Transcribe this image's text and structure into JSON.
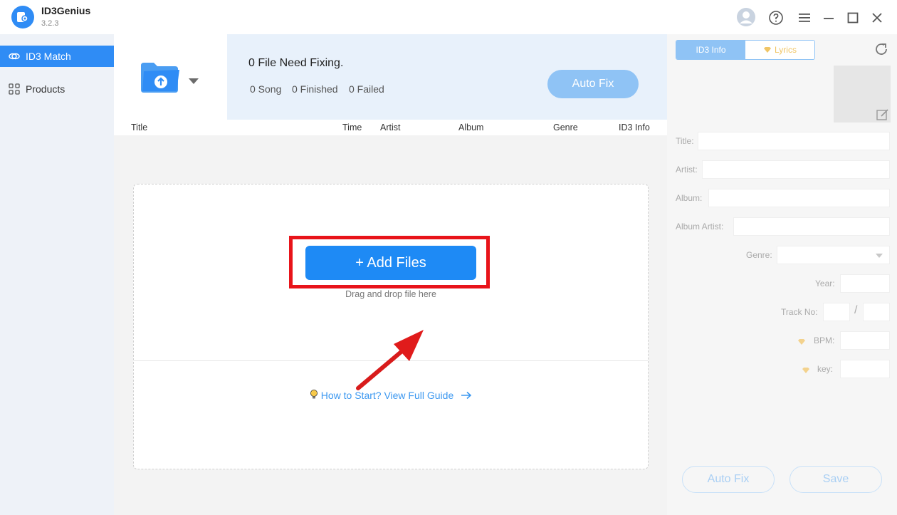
{
  "app": {
    "name": "ID3Genius",
    "version": "3.2.3"
  },
  "titlebar": {
    "icons": [
      "user-icon",
      "help-icon",
      "menu-icon",
      "minimize-icon",
      "maximize-icon",
      "close-icon"
    ]
  },
  "sidebar": {
    "items": [
      {
        "label": "ID3 Match",
        "icon": "link-icon",
        "active": true
      },
      {
        "label": "Products",
        "icon": "grid-icon",
        "active": false
      }
    ]
  },
  "status": {
    "title": "0 File Need Fixing.",
    "song": "0 Song",
    "finished": "0 Finished",
    "failed": "0 Failed",
    "auto_fix_label": "Auto Fix"
  },
  "table": {
    "columns": [
      "Title",
      "Time",
      "Artist",
      "Album",
      "Genre",
      "ID3 Info"
    ]
  },
  "dropzone": {
    "add_files_label": "+ Add Files",
    "drag_text": "Drag and drop file here",
    "guide_text": "How to Start? View Full Guide"
  },
  "right_panel": {
    "tabs": [
      "ID3 Info",
      "Lyrics"
    ],
    "fields": {
      "title": "Title:",
      "artist": "Artist:",
      "album": "Album:",
      "album_artist": "Album Artist:",
      "genre": "Genre:",
      "year": "Year:",
      "track_no": "Track No:",
      "track_sep": "/",
      "bpm": "BPM:",
      "key": "key:"
    },
    "auto_fix_label": "Auto Fix",
    "save_label": "Save"
  },
  "colors": {
    "accent": "#1e8af5",
    "highlight": "#e8141a",
    "premium": "#f0c566"
  }
}
